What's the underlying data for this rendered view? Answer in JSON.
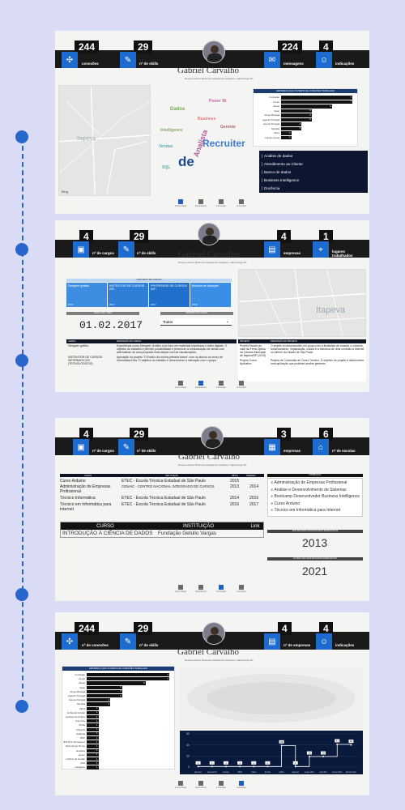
{
  "profile": {
    "name": "Gabriel Carvalho",
    "subtitle": "Desenvolvedor Business Intelligence Analytics | Itapetininga SP"
  },
  "panel1": {
    "kpis": [
      {
        "value": "244",
        "label": "conexões",
        "icon": "network-icon"
      },
      {
        "value": "29",
        "label": "nº de skills",
        "icon": "pen-icon"
      },
      {
        "value": "224",
        "label": "mensagens",
        "icon": "mail-icon"
      },
      {
        "value": "4",
        "label": "indicações",
        "icon": "people-icon"
      }
    ],
    "map_city": "Itapeva",
    "map_credit": "Bing",
    "wordcloud": [
      "Recruiter",
      "de",
      "Analista",
      "Dados",
      "Business",
      "Intelligence",
      "Power BI",
      "SQL",
      "Gerente",
      "Vendas"
    ],
    "bar_title": "EMPRESAS QUE OS PERFIS DE CONEXÕES TRABALHAM",
    "bars": [
      {
        "label": "Fundação",
        "value": 7
      },
      {
        "label": "Grupo",
        "value": 7
      },
      {
        "label": "Senac",
        "value": 5
      },
      {
        "label": "Assaí",
        "value": 3
      },
      {
        "label": "Grupo Mariaga",
        "value": 3
      },
      {
        "label": "Agee37 Portugal",
        "value": 3
      },
      {
        "label": "Aureus Portugal",
        "value": 2
      },
      {
        "label": "Mundial",
        "value": 2
      },
      {
        "label": "Africa",
        "value": 1
      },
      {
        "label": "Autotec Acqua",
        "value": 1
      }
    ],
    "skills": [
      "Análise de dados",
      "Atendimento ao Cliente",
      "Banco de dados",
      "Business Intelligence",
      "Docência"
    ]
  },
  "panel2": {
    "kpis": [
      {
        "value": "4",
        "label": "nº de cargos",
        "icon": "briefcase-icon"
      },
      {
        "value": "29",
        "label": "nº de skills",
        "icon": "pen-icon"
      },
      {
        "value": "4",
        "label": "empresas",
        "icon": "building-icon"
      },
      {
        "value": "1",
        "label": "lugares trabalhados",
        "icon": "pin-icon"
      }
    ],
    "timeline_title": "HISTÓRICO DE CARGOS",
    "timeline": [
      {
        "title": "Designer gráfico",
        "year": "2017"
      },
      {
        "title": "INSTRUTOR DE CURSOS INF...",
        "year": "2017"
      },
      {
        "title": "PROFESSOR DE CURSOS INF...",
        "year": "2017"
      },
      {
        "title": "Bolsista de Iniciação",
        "year": "2019"
      }
    ],
    "date_header": "DATA / ANO / MÊS",
    "date_value": "01.02.2017",
    "period_header": "PERÍODO DO CARGO",
    "period_value": "Todos",
    "map_city": "Itapeva",
    "table_headers": [
      "CARGO",
      "DESCRIÇÃO DO CARGO"
    ],
    "table_rows": [
      {
        "cargo": "Designer gráfico",
        "desc": "Experiência como Designer Gráfico com foco em materiais impressos e artes digitais. O objetivo do trabalho é permitir possibilidade e promover a comunicação de ideias com alternativas de uma proposta mais ampla com as visualizações."
      },
      {
        "cargo": "INSTRUTOR DE CURSOS INFORMÁTICOS (TECNOLÓGICOS)",
        "desc": "Aplicação do projeto \"O Ensino da minha primeira dama\" com os alunos do curso de Informática Kids. O objetivo do trabalho é desenvolver a interação com o grupo."
      }
    ],
    "proj_headers": [
      "PROJETO",
      "DESCRIÇÃO DO PROJETO"
    ],
    "projects": [
      {
        "name": "Projeto Estudo de caso da Ferra Óptica na Câmara Municipal de Itapeva/SP (2019)",
        "desc": "O projeto foi desenvolvido em grupo com a finalidade de mostrar o conceito, funcionamento, implantação, custos e a estrutura de uma conexão à Internet no interior do estado de São Paulo."
      },
      {
        "name": "Projeto Curso Aplicativo",
        "desc": "Projeto de Conclusão de Curso Técnico. O objetivo do projeto é desenvolver uma aplicação que pudesse auxiliar gestores."
      }
    ]
  },
  "panel3": {
    "kpis": [
      {
        "value": "4",
        "label": "nº de cargos",
        "icon": "briefcase-icon"
      },
      {
        "value": "29",
        "label": "nº de skills",
        "icon": "pen-icon"
      },
      {
        "value": "3",
        "label": "empresas",
        "icon": "calendar-icon"
      },
      {
        "value": "6",
        "label": "nº de escolas",
        "icon": "school-icon"
      }
    ],
    "course_headers": [
      "CURSO",
      "INSTITUIÇÃO",
      "INÍCIO",
      "TÉRMINO"
    ],
    "courses": [
      {
        "curso": "Curso Arduino",
        "inst": "ETEC - Escola Técnica Estadual de São Paulo",
        "ini": "2015",
        "fim": ""
      },
      {
        "curso": "Administração de Empresas Profissional",
        "inst": "CENAIC - CENTRO NACIONAL INTEGRADO DE CURSOS",
        "ini": "2013",
        "fim": "2014"
      },
      {
        "curso": "Técnico Informática",
        "inst": "ETEC - Escola Técnica Estadual de São Paulo",
        "ini": "2014",
        "fim": "2016"
      },
      {
        "curso": "Técnico em Informática para Internet",
        "inst": "ETEC - Escola Técnica Estadual de São Paulo",
        "ini": "2016",
        "fim": "2017"
      }
    ],
    "box_headers": [
      "CURSO",
      "INSTITUIÇÃO",
      "Link"
    ],
    "box_row": {
      "curso": "INTRODUÇÃO À CIÊNCIA DE DADOS",
      "inst": "Fundação Getulio Vargas"
    },
    "formacao_title": "FORMAÇÃO",
    "formacao": [
      "Administração de Empresas Profissional",
      "Análise e Desenvolvimento de Sistemas",
      "Bootcamp Desenvolvedor Business Intelligence",
      "Curso Arduino",
      "Técnico em Informática para Internet"
    ],
    "first_year_title": "ANO DE INÍCIO DOS ESTUDOS ESPECÍFICOS",
    "first_year": "2013",
    "last_year_title": "ÚLTIMO ANO DOS ESTUDOS ESPECÍFICOS",
    "last_year": "2021"
  },
  "panel4": {
    "kpis": [
      {
        "value": "244",
        "label": "nº de conexões",
        "icon": "network-icon"
      },
      {
        "value": "29",
        "label": "nº de skills",
        "icon": "pen-icon"
      },
      {
        "value": "4",
        "label": "nº de empresas",
        "icon": "building-icon"
      },
      {
        "value": "4",
        "label": "indicações",
        "icon": "people-icon"
      }
    ],
    "bar_title": "EMPRESAS QUE OS PERFIS DE CONEXÕES TRABALHAM",
    "bars": [
      {
        "label": "Fundação",
        "value": 7
      },
      {
        "label": "Grupo",
        "value": 7
      },
      {
        "label": "Senac",
        "value": 5
      },
      {
        "label": "Assaí",
        "value": 3
      },
      {
        "label": "Grupo Mariaga",
        "value": 3
      },
      {
        "label": "Agee37 Portugal",
        "value": 3
      },
      {
        "label": "Aureus Portugal",
        "value": 2
      },
      {
        "label": "Mundial",
        "value": 2
      },
      {
        "label": "Africa",
        "value": 1
      },
      {
        "label": "Ambiental Jundiaí",
        "value": 1
      },
      {
        "label": "Ambiga Informática",
        "value": 1
      },
      {
        "label": "Ana Cura",
        "value": 1
      },
      {
        "label": "Ancila",
        "value": 1
      },
      {
        "label": "Anhembi",
        "value": 1
      },
      {
        "label": "Auditoria",
        "value": 1
      },
      {
        "label": "BCF",
        "value": 1
      },
      {
        "label": "BOLD for Developers",
        "value": 1
      },
      {
        "label": "Delta Group Promo",
        "value": 1
      },
      {
        "label": "Euclides",
        "value": 1
      },
      {
        "label": "Execo",
        "value": 1
      },
      {
        "label": "Instituto de Gestão",
        "value": 1
      },
      {
        "label": "Jobs",
        "value": 1
      },
      {
        "label": "Instagram",
        "value": 1
      }
    ]
  },
  "chart_data": {
    "type": "line",
    "categories": [
      "janeiro",
      "fevereiro",
      "março",
      "abril",
      "maio",
      "junho",
      "julho",
      "agosto",
      "setembro",
      "outubro",
      "novembro",
      "dezembro"
    ],
    "values": [
      1,
      1,
      1,
      1,
      1,
      1,
      39,
      1,
      19,
      19,
      41,
      40
    ],
    "ylim": [
      0,
      60
    ],
    "yticks": [
      0,
      20,
      40,
      60
    ]
  },
  "nav": [
    "Home Page",
    "Experiência",
    "Formação",
    "Conexões"
  ]
}
